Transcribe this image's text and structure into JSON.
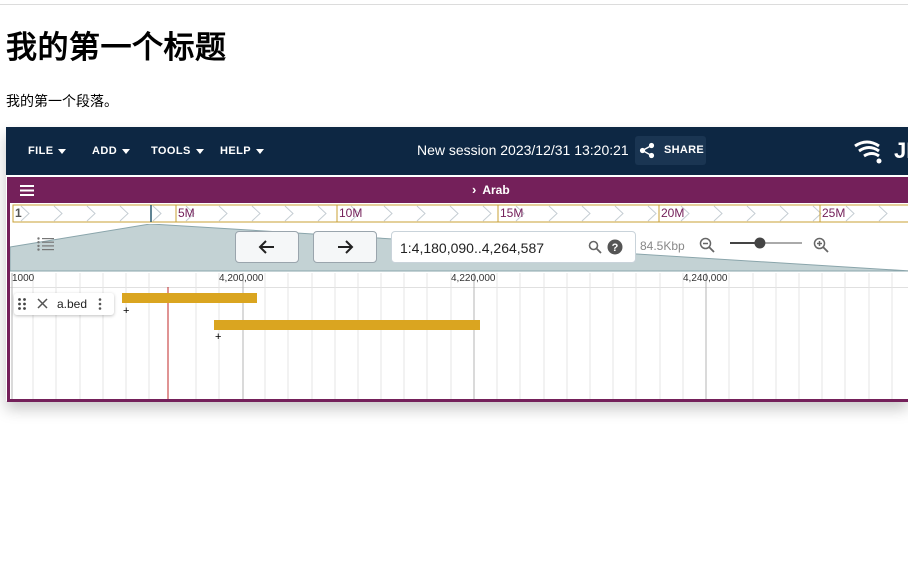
{
  "page": {
    "heading": "我的第一个标题",
    "paragraph": "我的第一个段落。"
  },
  "app": {
    "menus": [
      "FILE",
      "ADD",
      "TOOLS",
      "HELP"
    ],
    "session_title": "New session 2023/12/31 13:20:21",
    "share_label": "SHARE",
    "logo_text": "JB",
    "colors": {
      "appbar": "#0d2743",
      "view_header": "#74205a",
      "feature": "#daa520"
    }
  },
  "view": {
    "assembly_name": "Arab",
    "overview": {
      "chromosome": "1",
      "labels": [
        "5M",
        "10M",
        "15M",
        "20M",
        "25M"
      ]
    },
    "locstring": "1:4,180,090..4,264,587",
    "bp_count": "84.5Kbp",
    "zoom_level": 0.4,
    "ruler": {
      "labels": [
        "1000",
        "4,200,000",
        "4,220,000",
        "4,240,000"
      ]
    }
  },
  "tracks": [
    {
      "name": "a.bed",
      "features": [
        {
          "strand": "+"
        },
        {
          "strand": "+"
        }
      ]
    }
  ]
}
